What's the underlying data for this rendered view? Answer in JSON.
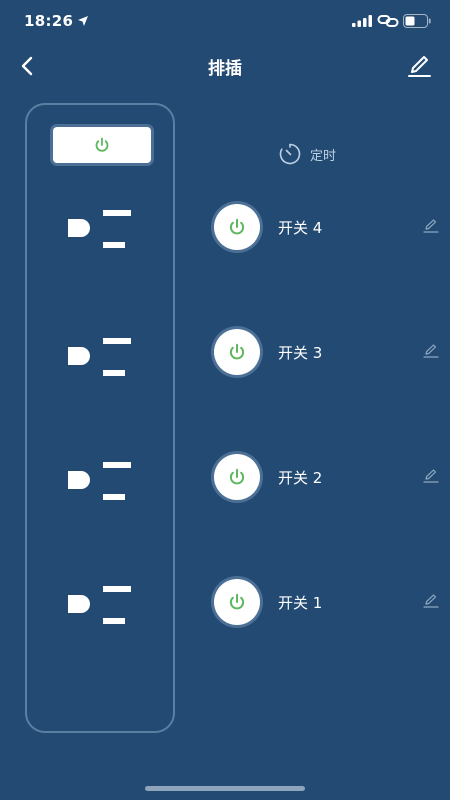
{
  "status_bar": {
    "time": "18:26"
  },
  "header": {
    "title": "排插"
  },
  "timer": {
    "label": "定时"
  },
  "switches": [
    {
      "label": "开关 4"
    },
    {
      "label": "开关 3"
    },
    {
      "label": "开关 2"
    },
    {
      "label": "开关 1"
    }
  ],
  "colors": {
    "background": "#234a72",
    "panel_border": "#5b7ea3",
    "power_on_green": "#5cb85c",
    "text": "#ffffff"
  }
}
